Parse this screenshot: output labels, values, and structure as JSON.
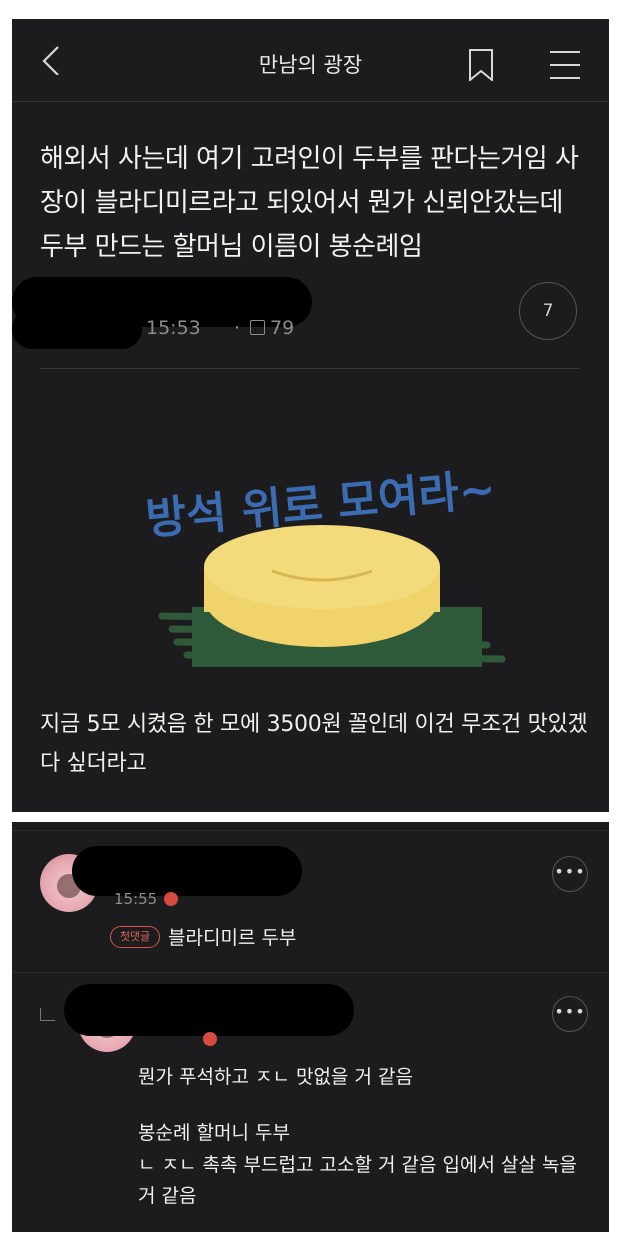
{
  "header": {
    "title": "만남의 광장"
  },
  "post": {
    "title": "해외서 사는데 여기 고려인이 두부를 판다는거임 사장이 블라디미르라고 되있어서 뭔가 신뢰안갔는데 두부 만드는 할머님 이름이 봉순례임",
    "time": "15:53",
    "views": "79",
    "comment_count": "7",
    "sticker_text": "방석 위로 모여라~",
    "body": "지금 5모 시켰음 한 모에 3500원 꼴인데 이건 무조건 맛있겠다 싶더라고"
  },
  "comments": [
    {
      "time": "15:55",
      "badge": "첫댓글",
      "text": "블라디미르 두부"
    },
    {
      "lines": [
        "뭔가 푸석하고 ㅈㄴ 맛없을 거 같음",
        "봉순례 할머니 두부",
        "ㄴ ㅈㄴ 촉촉 부드럽고 고소할 거 같음 입에서 살살 녹을 거 같음"
      ]
    }
  ],
  "icons": {
    "back": "chevron-left-icon",
    "bookmark": "bookmark-icon",
    "menu": "hamburger-menu-icon",
    "more": "more-dots-icon"
  },
  "colors": {
    "background": "#1c1c1e",
    "badge": "#d6534a",
    "sticker_text": "#3b6bb0",
    "tofu": "#f0d36b",
    "mat": "#2f5a3a"
  }
}
